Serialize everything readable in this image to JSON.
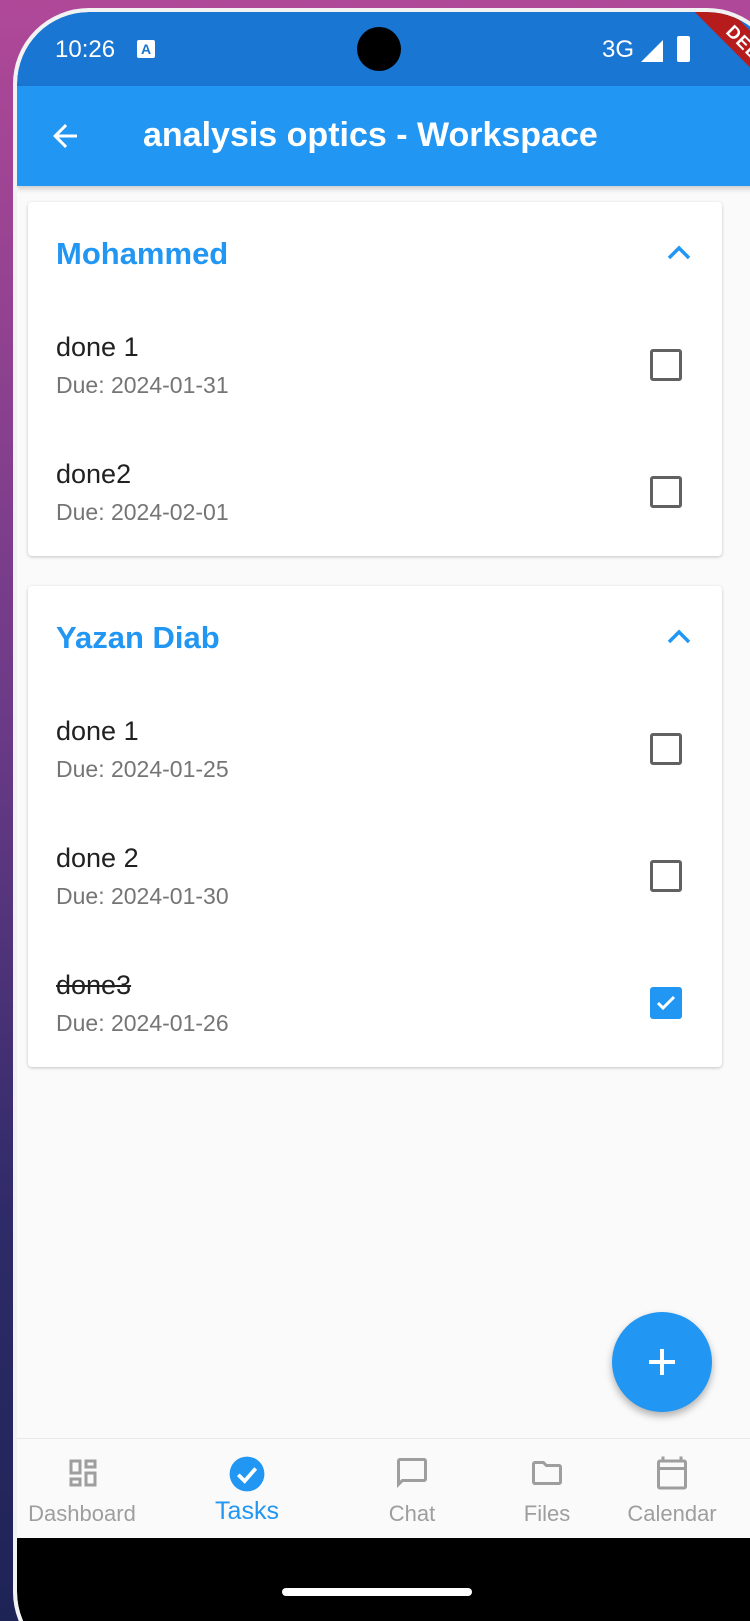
{
  "status_bar": {
    "time": "10:26",
    "notification_glyph": "A",
    "network": "3G",
    "debug_label": "DEBUG"
  },
  "app_bar": {
    "title": "analysis optics - Workspace"
  },
  "groups": [
    {
      "name": "Mohammed",
      "tasks": [
        {
          "name": "done 1",
          "due": "Due: 2024-01-31",
          "completed": false
        },
        {
          "name": "done2",
          "due": "Due: 2024-02-01",
          "completed": false
        }
      ]
    },
    {
      "name": "Yazan Diab",
      "tasks": [
        {
          "name": "done 1",
          "due": "Due: 2024-01-25",
          "completed": false
        },
        {
          "name": "done 2",
          "due": "Due: 2024-01-30",
          "completed": false
        },
        {
          "name": "done3",
          "due": "Due: 2024-01-26",
          "completed": true
        }
      ]
    }
  ],
  "bottom_nav": {
    "items": [
      {
        "label": "Dashboard",
        "icon": "dashboard-icon",
        "active": false
      },
      {
        "label": "Tasks",
        "icon": "check-circle-icon",
        "active": true
      },
      {
        "label": "Chat",
        "icon": "chat-bubble-icon",
        "active": false
      },
      {
        "label": "Files",
        "icon": "folder-icon",
        "active": false
      },
      {
        "label": "Calendar",
        "icon": "calendar-icon",
        "active": false
      }
    ]
  },
  "colors": {
    "primary": "#2196f3",
    "status_bar": "#1976d2",
    "inactive": "#9e9e9e"
  }
}
